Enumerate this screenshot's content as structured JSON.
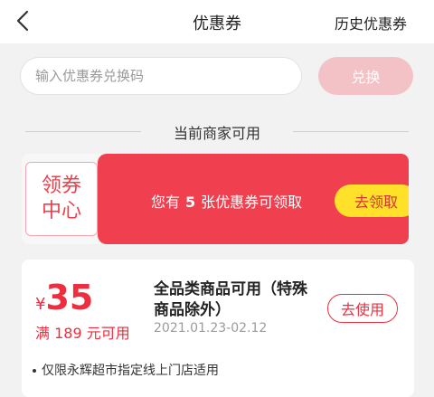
{
  "navbar": {
    "title": "优惠券",
    "history_label": "历史优惠券"
  },
  "redeem": {
    "placeholder": "输入优惠券兑换码",
    "value": "",
    "button_label": "兑换"
  },
  "section": {
    "title": "当前商家可用"
  },
  "banner": {
    "badge_line1": "领券",
    "badge_line2": "中心",
    "text_prefix": "您有",
    "count": "5",
    "text_suffix": "张优惠券可领取",
    "button_label": "去领取"
  },
  "coupon": {
    "currency_symbol": "¥",
    "amount": "35",
    "threshold": "满 189 元可用",
    "description": "全品类商品可用（特殊商品除外）",
    "date_range": "2021.01.23-02.12",
    "use_label": "去使用",
    "rule": "仅限永辉超市指定线上门店适用"
  },
  "colors": {
    "accent": "#ee2e3f",
    "banner_red": "#f0404f",
    "claim_yellow": "#ffe12a",
    "redeem_disabled": "#f3c2c6"
  }
}
